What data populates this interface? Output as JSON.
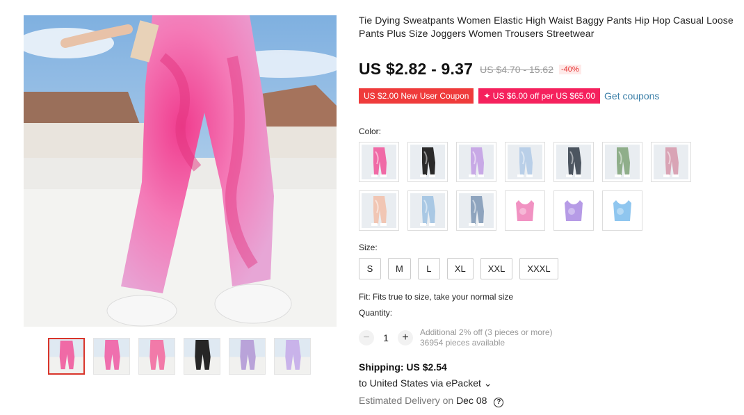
{
  "product": {
    "title": "Tie Dying Sweatpants Women Elastic High Waist Baggy Pants Hip Hop Casual Loose Pants Plus Size Joggers Women Trousers Streetwear"
  },
  "price": {
    "current": "US $2.82 - 9.37",
    "original": "US $4.70 - 15.62",
    "discount": "-40%"
  },
  "coupons": {
    "new_user": "US $2.00 New User Coupon",
    "store": "✦ US $6.00 off per US $65.00",
    "get_link": "Get coupons"
  },
  "color": {
    "label": "Color:",
    "options": [
      {
        "name": "pink tie-dye pants",
        "color": "#f06aa6"
      },
      {
        "name": "black tie-dye pants",
        "color": "#2a2a2a"
      },
      {
        "name": "lilac tie-dye pants",
        "color": "#c8a9e6"
      },
      {
        "name": "light blue tie-dye pants",
        "color": "#b9cfe8"
      },
      {
        "name": "dark grey tie-dye pants",
        "color": "#4c5560"
      },
      {
        "name": "green tie-dye pants",
        "color": "#8fae8a"
      },
      {
        "name": "pink-grey tie-dye pants",
        "color": "#d9a4b5"
      },
      {
        "name": "peach tie-dye pants",
        "color": "#f1c6b4"
      },
      {
        "name": "sky blue tie-dye pants",
        "color": "#a9c8e4"
      },
      {
        "name": "blue-grey tie-dye pants",
        "color": "#8ea4be"
      },
      {
        "name": "pink tie-dye top",
        "color": "#f192c2"
      },
      {
        "name": "purple tie-dye top",
        "color": "#b69be6"
      },
      {
        "name": "blue tie-dye top",
        "color": "#8fc6ef"
      }
    ]
  },
  "size": {
    "label": "Size:",
    "options": [
      "S",
      "M",
      "L",
      "XL",
      "XXL",
      "XXXL"
    ]
  },
  "fit_note": "Fit: Fits true to size, take your normal size",
  "quantity": {
    "label": "Quantity:",
    "minus": "−",
    "value": "1",
    "plus": "+",
    "discount_note": "Additional 2% off (3 pieces or more)",
    "available": "36954 pieces available"
  },
  "shipping": {
    "cost": "Shipping: US $2.54",
    "destination": "to United States via ePacket ⌄",
    "delivery_label": "Estimated Delivery on",
    "delivery_date": "Dec 08",
    "help": "?"
  },
  "gallery": {
    "thumbnails": [
      "#f06aa6",
      "#ef6fae",
      "#f27aa9",
      "#262626",
      "#b9a3d9",
      "#c9b3ea"
    ]
  }
}
